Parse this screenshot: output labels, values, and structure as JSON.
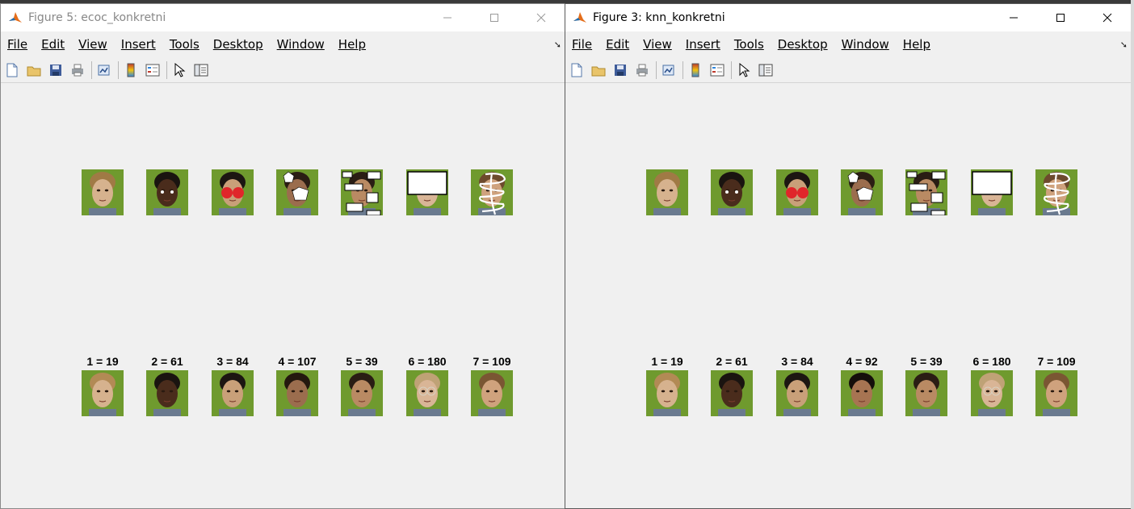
{
  "windows": [
    {
      "id": "left",
      "title": "Figure 5: ecoc_konkretni",
      "menu": [
        "File",
        "Edit",
        "View",
        "Insert",
        "Tools",
        "Desktop",
        "Window",
        "Help"
      ],
      "captions": [
        "1 = 19",
        "2 = 61",
        "3 = 84",
        "4 = 107",
        "5 = 39",
        "6 = 180",
        "7 = 109"
      ]
    },
    {
      "id": "right",
      "title": "Figure 3: knn_konkretni",
      "menu": [
        "File",
        "Edit",
        "View",
        "Insert",
        "Tools",
        "Desktop",
        "Window",
        "Help"
      ],
      "captions": [
        "1 = 19",
        "2 = 61",
        "3 = 84",
        "4 = 92",
        "5 = 39",
        "6 = 180",
        "7 = 109"
      ]
    }
  ],
  "occlusions": [
    "none",
    "white-eye-dots",
    "red-eye-circles",
    "white-pentagons",
    "white-rectangles",
    "white-box-over-eyes",
    "white-scribble"
  ],
  "toolbar_icons": [
    "new-figure-icon",
    "open-file-icon",
    "save-icon",
    "print-icon",
    "link-plot-icon",
    "insert-colorbar-icon",
    "insert-legend-icon",
    "edit-plot-arrow-icon",
    "property-inspector-icon"
  ],
  "colors": {
    "face_background": "#6f9a2e",
    "occlusion_white": "#ffffff",
    "occlusion_red": "#e0262a"
  }
}
